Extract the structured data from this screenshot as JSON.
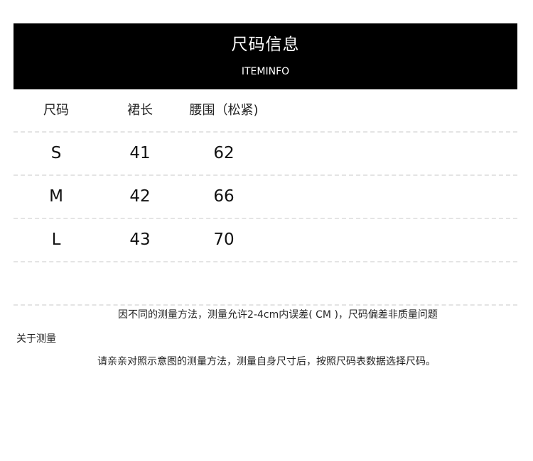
{
  "header": {
    "title": "尺码信息",
    "subtitle": "ITEMINFO"
  },
  "table": {
    "columns": [
      "尺码",
      "裙长",
      "腰围（松紧)"
    ],
    "rows": [
      [
        "S",
        "41",
        "62"
      ],
      [
        "M",
        "42",
        "66"
      ],
      [
        "L",
        "43",
        "70"
      ]
    ]
  },
  "notes": {
    "disclaimer": "因不同的测量方法，测量允许2-4cm内误差( CM )，尺码偏差非质量问题",
    "about": "关于测量",
    "instruction": "请亲亲对照示意图的测量方法，测量自身尺寸后，按照尺码表数据选择尺码。"
  }
}
